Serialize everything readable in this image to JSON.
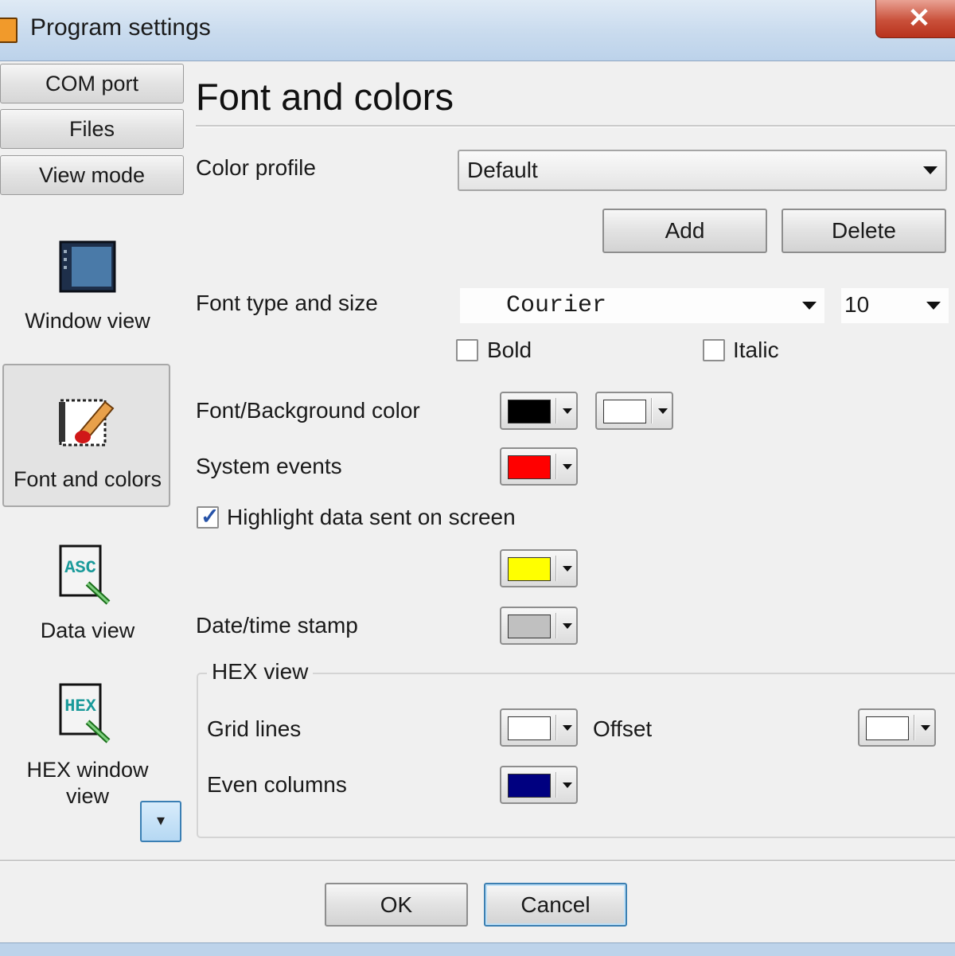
{
  "window": {
    "title": "Program settings",
    "close_glyph": "✕"
  },
  "nav": {
    "tabs": [
      "COM port",
      "Files",
      "View mode"
    ],
    "items": [
      {
        "label": "Window view",
        "icon": "window-view-icon"
      },
      {
        "label": "Font and colors",
        "icon": "font-colors-icon",
        "selected": true
      },
      {
        "label": "Data view",
        "icon": "ascii-data-icon",
        "icon_text": "ASC"
      },
      {
        "label": "HEX window view",
        "icon": "hex-window-icon",
        "icon_text": "HEX"
      }
    ]
  },
  "main": {
    "heading": "Font and colors",
    "color_profile": {
      "label": "Color profile",
      "value": "Default"
    },
    "add_label": "Add",
    "delete_label": "Delete",
    "font": {
      "label": "Font type and size",
      "family": "Courier",
      "size": "10",
      "bold_label": "Bold",
      "bold_checked": false,
      "italic_label": "Italic",
      "italic_checked": false
    },
    "font_bg": {
      "label": "Font/Background color",
      "font_color": "#000000",
      "background_color": "#ffffff"
    },
    "system_events": {
      "label": "System events",
      "color": "#ff0000"
    },
    "highlight": {
      "label": "Highlight data sent on screen",
      "checked": true,
      "color": "#ffff00"
    },
    "date_time": {
      "label": "Date/time stamp",
      "color": "#c0c0c0"
    },
    "hex_view": {
      "title": "HEX view",
      "grid_lines": {
        "label": "Grid lines",
        "color": "#ffffff"
      },
      "offset": {
        "label": "Offset",
        "color": "#ffffff"
      },
      "even_columns": {
        "label": "Even columns",
        "color": "#000080"
      }
    }
  },
  "footer": {
    "ok_label": "OK",
    "cancel_label": "Cancel"
  }
}
